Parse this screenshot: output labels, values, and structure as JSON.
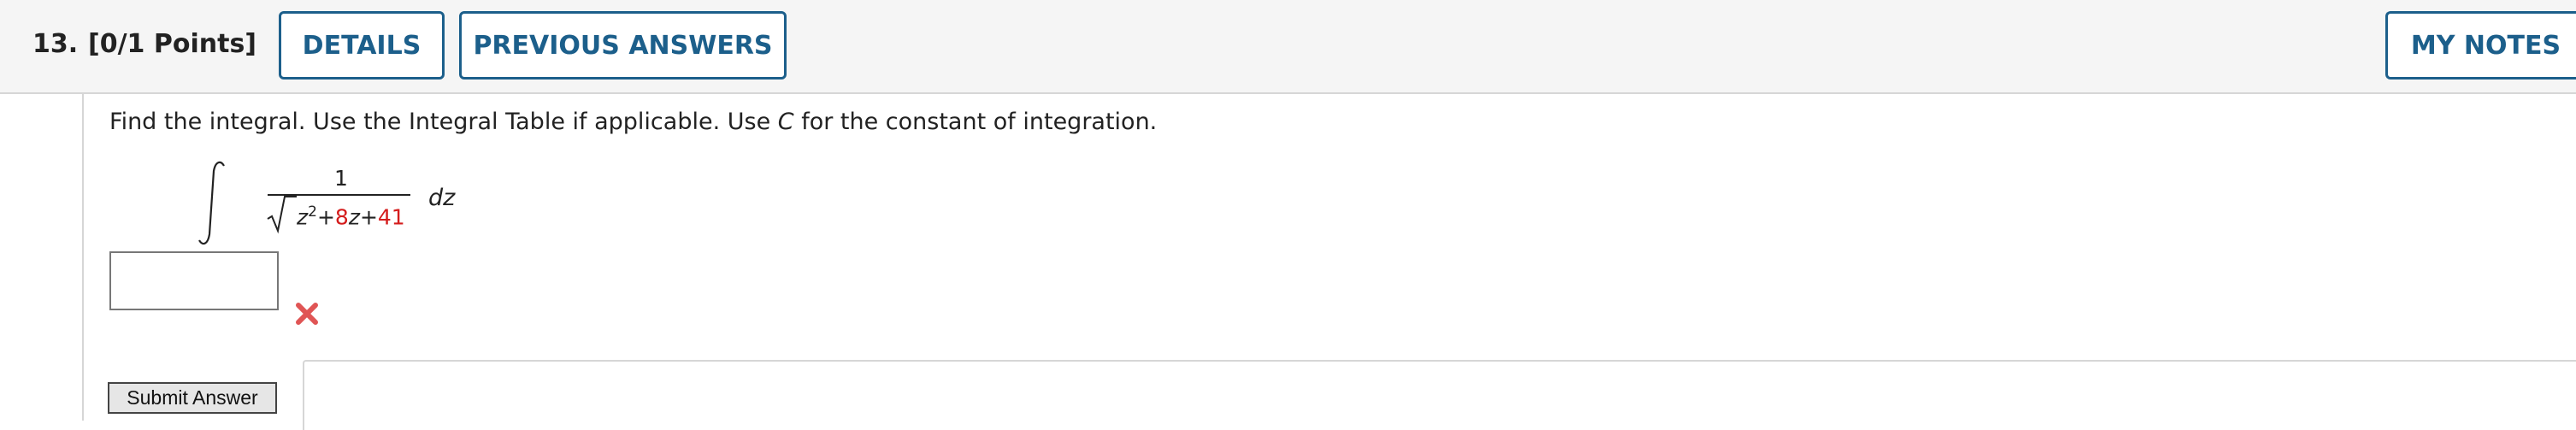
{
  "question": {
    "number": "13.",
    "points": "[0/1 Points]"
  },
  "header_buttons": {
    "details": "DETAILS",
    "previous_answers": "PREVIOUS ANSWERS",
    "my_notes": "MY NOTES"
  },
  "prompt": {
    "before": "Find the integral. Use the Integral Table if applicable. Use ",
    "variable": "C",
    "after": " for the constant of integration."
  },
  "formula": {
    "numerator": "1",
    "z_var": "z",
    "exponent": "2",
    "plus1": "+",
    "coef": "8",
    "z_var2": "z",
    "plus2": "+",
    "constant": "41",
    "differential": "dz"
  },
  "answer": {
    "value": "",
    "status": "incorrect",
    "status_icon": "x-mark-icon",
    "status_color": "#e05555"
  },
  "submit_label": "Submit Answer",
  "colors": {
    "accent": "#1c5f8b",
    "randomized_value": "#d41c1c"
  }
}
